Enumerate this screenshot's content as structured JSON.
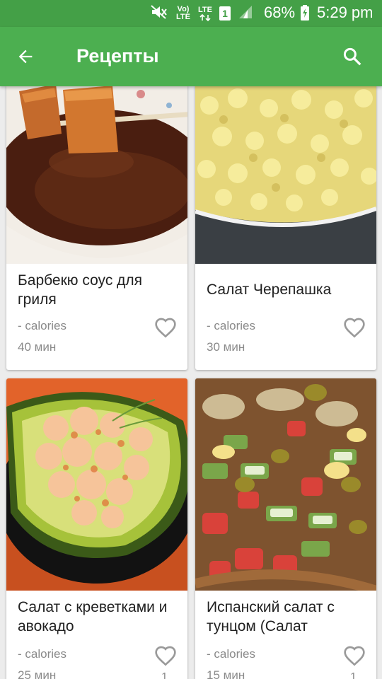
{
  "status_bar": {
    "icons": [
      "mute-icon",
      "volte-icon",
      "lte-icon",
      "sim1-icon",
      "signal-icon",
      "battery-charging-icon"
    ],
    "volte_label": "Vo) LTE",
    "lte_label": "LTE",
    "sim_label": "1",
    "battery": "68%",
    "time": "5:29 pm"
  },
  "app_bar": {
    "title": "Рецепты",
    "back_icon": "arrow-back-icon",
    "search_icon": "search-icon"
  },
  "recipes": [
    {
      "name": "Барбекю соус для гриля",
      "calories": "- calories",
      "time": "40 мин",
      "favorite": false,
      "likes": ""
    },
    {
      "name": "Салат Черепашка",
      "calories": "- calories",
      "time": "30 мин",
      "favorite": false,
      "likes": ""
    },
    {
      "name": "Салат с креветками и авокадо",
      "calories": "- calories",
      "time": "25 мин",
      "favorite": false,
      "likes": "1"
    },
    {
      "name": "Испанский салат с тунцом (Салат",
      "calories": "- calories",
      "time": "15 мин",
      "favorite": false,
      "likes": "1"
    }
  ],
  "colors": {
    "status_bar": "#44a047",
    "app_bar": "#4caf50",
    "background": "#ececec",
    "card": "#ffffff",
    "title_text": "#212121",
    "secondary_text": "#8a8a8a"
  }
}
